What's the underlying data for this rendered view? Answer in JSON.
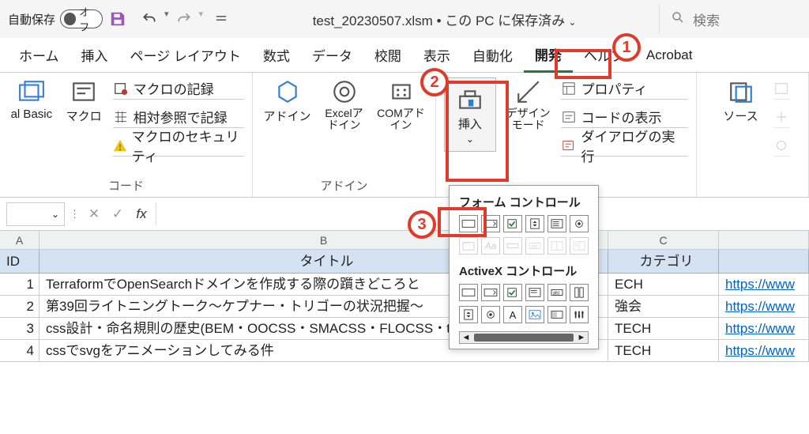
{
  "titlebar": {
    "autosave_label": "自動保存",
    "toggle_text": "オフ",
    "title": "test_20230507.xlsm • この PC に保存済み",
    "search_placeholder": "検索"
  },
  "tabs": {
    "home": "ホーム",
    "insert": "挿入",
    "pagelayout": "ページ レイアウト",
    "formulas": "数式",
    "data": "データ",
    "review": "校閲",
    "view": "表示",
    "automate": "自動化",
    "developer": "開発",
    "help": "ヘルプ",
    "acrobat": "Acrobat"
  },
  "ribbon": {
    "code_group": "コード",
    "basic": "al Basic",
    "macro": "マクロ",
    "record_macro": "マクロの記録",
    "relative_ref": "相対参照で記録",
    "macro_security": "マクロのセキュリティ",
    "addins_group": "アドイン",
    "addin": "アドイン",
    "excel_addin": "Excelアドイン",
    "com_addin": "COMアドイン",
    "insert_ctrl": "挿入",
    "design_mode": "デザインモード",
    "properties": "プロパティ",
    "view_code": "コードの表示",
    "run_dialog": "ダイアログの実行",
    "source": "ソース"
  },
  "controls_dropdown": {
    "form_controls": "フォーム コントロール",
    "activex_controls": "ActiveX コントロール"
  },
  "gridhdr": {
    "A": "A",
    "B": "B",
    "C": "C"
  },
  "header": {
    "id": "ID",
    "title": "タイトル",
    "cat": "カテゴリ"
  },
  "rows": [
    {
      "id": "1",
      "title": "TerraformでOpenSearchドメインを作成する際の躓きどころと",
      "cat": "ECH",
      "url": "https://www"
    },
    {
      "id": "2",
      "title": "第39回ライトニングトーク～ケプナー・トリゴーの状況把握～",
      "cat": "強会",
      "url": "https://www"
    },
    {
      "id": "3",
      "title": "css設計・命名規則の歴史(BEM・OOCSS・SMACSS・FLOCSS・tailwindcss)",
      "cat": "TECH",
      "url": "https://www"
    },
    {
      "id": "4",
      "title": "cssでsvgをアニメーションしてみる件",
      "cat": "TECH",
      "url": "https://www"
    }
  ],
  "callouts": {
    "c1": "1",
    "c2": "2",
    "c3": "3"
  }
}
